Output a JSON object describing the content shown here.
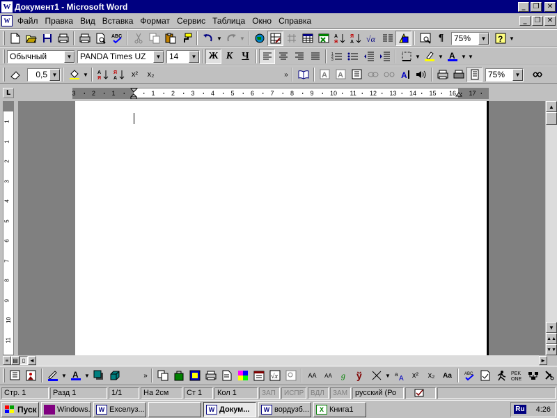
{
  "window": {
    "title": "Документ1 - Microsoft Word",
    "app_icon": "word-icon",
    "caption_buttons": [
      "minimize-icon",
      "maximize-icon",
      "close-icon"
    ]
  },
  "menu": {
    "items": [
      "Файл",
      "Правка",
      "Вид",
      "Вставка",
      "Формат",
      "Сервис",
      "Таблица",
      "Окно",
      "Справка"
    ]
  },
  "standard_toolbar": {
    "zoom": "75%",
    "icons": [
      "new-document-icon",
      "open-folder-icon",
      "save-icon",
      "save-all-icon",
      "print-icon",
      "print-preview-icon",
      "spelling-icon",
      "cut-icon",
      "copy-icon",
      "paste-icon",
      "format-painter-icon",
      "undo-icon",
      "redo-icon",
      "web-toolbar-icon",
      "tables-borders-icon",
      "insert-table-icon",
      "insert-excel-icon",
      "columns-icon",
      "drawing-icon",
      "document-map-icon",
      "show-hide-icon",
      "help-icon"
    ]
  },
  "formatting_toolbar": {
    "style": "Обычный",
    "font": "PANDA Times UZ",
    "size": "14",
    "bold": "Ж",
    "italic": "К",
    "underline": "Ч",
    "colors": {
      "highlight": "#ffff00",
      "font_color": "#0000ff",
      "line": "#0000ff"
    }
  },
  "tables_toolbar": {
    "line_weight": "0,5",
    "zoom": "75%",
    "superscript": "x²",
    "subscript": "x₂"
  },
  "ruler": {
    "h_numbers": [
      "3",
      "2",
      "1",
      "1",
      "2",
      "3",
      "4",
      "5",
      "6",
      "7",
      "8",
      "9",
      "10",
      "11",
      "12",
      "13",
      "14",
      "15",
      "16",
      "17"
    ],
    "v_numbers": [
      "1",
      "1",
      "2",
      "3",
      "4",
      "5",
      "6",
      "7",
      "8",
      "9",
      "10",
      "11",
      "12"
    ]
  },
  "status": {
    "page": "Стр. 1",
    "section": "Разд 1",
    "pages": "1/1",
    "at": "На 2см",
    "line": "Ст 1",
    "col": "Кол 1",
    "rec": "ЗАП",
    "trk": "ИСПР",
    "ext": "ВДЛ",
    "ovr": "ЗАМ",
    "language": "русский (Ро"
  },
  "taskbar": {
    "start": "Пуск",
    "tasks": [
      {
        "label": "Windows...",
        "icon": "folder-icon"
      },
      {
        "label": "Exceлуз...",
        "icon": "word-icon"
      },
      {
        "label": "",
        "icon": ""
      },
      {
        "label": "Докум...",
        "icon": "word-icon",
        "active": true
      },
      {
        "label": "вордузб...",
        "icon": "word-icon"
      },
      {
        "label": "Книга1",
        "icon": "excel-icon"
      }
    ],
    "lang_indicator": "Ru",
    "clock": "4:26"
  }
}
